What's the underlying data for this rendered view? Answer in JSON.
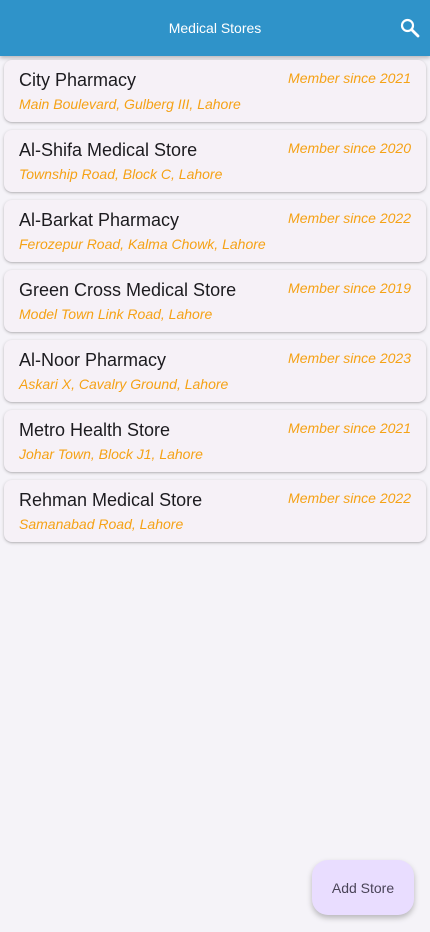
{
  "appbar": {
    "title": "Medical Stores",
    "search_icon": "search-icon",
    "color": "#2f93c9"
  },
  "stores": [
    {
      "name": "City Pharmacy",
      "address": "Main Boulevard, Gulberg III, Lahore",
      "member": "Member since 2021"
    },
    {
      "name": "Al-Shifa Medical Store",
      "address": "Township Road, Block C, Lahore",
      "member": "Member since 2020"
    },
    {
      "name": "Al-Barkat Pharmacy",
      "address": "Ferozepur Road, Kalma Chowk, Lahore",
      "member": "Member since 2022"
    },
    {
      "name": "Green Cross Medical Store",
      "address": "Model Town Link Road, Lahore",
      "member": "Member since 2019"
    },
    {
      "name": "Al-Noor Pharmacy",
      "address": "Askari X, Cavalry Ground, Lahore",
      "member": "Member since 2023"
    },
    {
      "name": "Metro Health Store",
      "address": "Johar Town, Block J1, Lahore",
      "member": "Member since 2021"
    },
    {
      "name": "Rehman Medical Store",
      "address": "Samanabad Road, Lahore",
      "member": "Member since 2022"
    }
  ],
  "fab": {
    "label": "Add Store"
  },
  "colors": {
    "accent": "#f5a216",
    "card_background": "#f6f1f7",
    "fab_background": "#e9ddff"
  }
}
